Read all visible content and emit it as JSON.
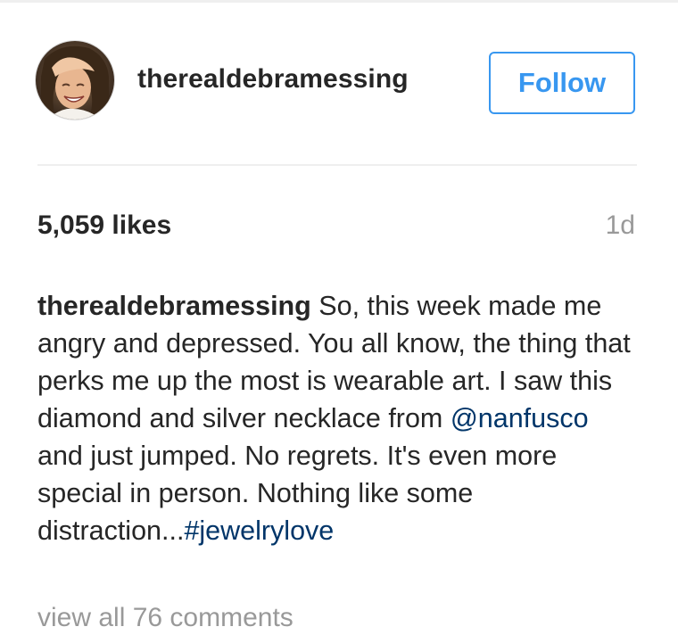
{
  "post": {
    "username": "therealdebramessing",
    "follow_label": "Follow",
    "likes": "5,059 likes",
    "timestamp": "1d"
  },
  "caption": {
    "username": "therealdebramessing",
    "text_1": " So, this week made me angry and depressed. You all know, the thing that perks me up the most is wearable art. I saw this diamond and silver necklace from ",
    "mention": "@nanfusco",
    "text_2": " and just jumped. No regrets. It's even more special in person. Nothing like some distraction...",
    "hashtag": "#jewelrylove"
  },
  "comments": {
    "view_all_label": "view all 76 comments"
  },
  "colors": {
    "accent": "#3897f0",
    "link": "#003569",
    "muted": "#999999",
    "text": "#262626"
  },
  "icons": {
    "avatar": "profile-photo"
  }
}
